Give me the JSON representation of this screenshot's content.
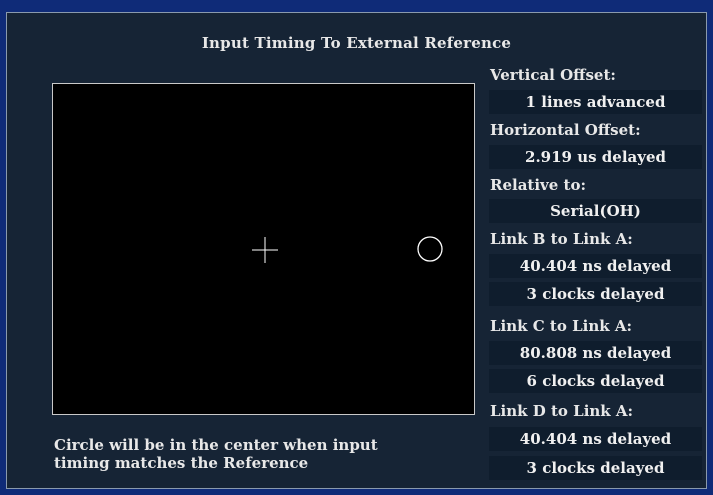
{
  "title": "Input Timing To External Reference",
  "note": {
    "line1": "Circle will be in the center when input",
    "line2": "timing matches the Reference"
  },
  "readouts": {
    "vertical_offset_label": "Vertical Offset:",
    "vertical_offset_value": "1 lines advanced",
    "horizontal_offset_label": "Horizontal Offset:",
    "horizontal_offset_value": "2.919 us delayed",
    "relative_to_label": "Relative to:",
    "relative_to_value": "Serial(OH)",
    "link_b_label": "Link B to Link A:",
    "link_b_ns": "40.404 ns delayed",
    "link_b_clocks": "3 clocks delayed",
    "link_c_label": "Link C to Link A:",
    "link_c_ns": "80.808 ns delayed",
    "link_c_clocks": "6 clocks delayed",
    "link_d_label": "Link D to Link A:",
    "link_d_ns": "40.404 ns delayed",
    "link_d_clocks": "3 clocks delayed"
  },
  "icons": {
    "reference_marker": "crosshair-icon",
    "timing_marker": "circle-icon"
  },
  "colors": {
    "panel_background": "#162435",
    "value_box": "#0f1d2d",
    "display_background": "#000000",
    "marker": "#ffffff"
  }
}
